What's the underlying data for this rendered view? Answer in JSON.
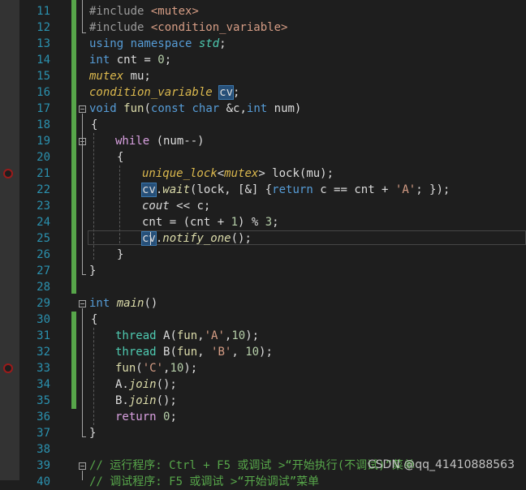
{
  "line_numbers": [
    "11",
    "12",
    "13",
    "14",
    "15",
    "16",
    "17",
    "18",
    "19",
    "20",
    "21",
    "22",
    "23",
    "24",
    "25",
    "26",
    "27",
    "28",
    "29",
    "30",
    "31",
    "32",
    "33",
    "34",
    "35",
    "36",
    "37",
    "38",
    "39",
    "40"
  ],
  "code": {
    "l11": {
      "a": "#include ",
      "b": "<mutex>"
    },
    "l12": {
      "a": "#include ",
      "b": "<condition_variable>"
    },
    "l13": {
      "a": "using ",
      "b": "namespace ",
      "c": "std",
      ";": ";"
    },
    "l14": {
      "a": "int ",
      "b": "cnt = ",
      "c": "0",
      "d": ";"
    },
    "l15": {
      "a": "mutex ",
      "b": "mu;"
    },
    "l16": {
      "a": "condition_variable ",
      "b": "cv",
      ";": ";"
    },
    "l17": {
      "a": "void ",
      "b": "fun",
      "c": "(",
      "d": "const ",
      "e": "char ",
      "f": "&c,",
      "g": "int ",
      "h": "num)"
    },
    "l18": {
      "a": "{"
    },
    "l19": {
      "a": "while ",
      "b": "(num--)"
    },
    "l20": {
      "a": "{"
    },
    "l21": {
      "a": "unique_lock",
      "b": "<",
      "c": "mutex",
      "d": "> lock(mu);"
    },
    "l22": {
      "a": "cv",
      "b": ".",
      "c": "wait",
      "d": "(lock, [&] {",
      "e": "return ",
      "f": "c == cnt + ",
      "g": "'A'",
      "h": "; });"
    },
    "l23": {
      "a": "cout ",
      "b": "<< c;"
    },
    "l24": {
      "a": "cnt = (cnt + ",
      "b": "1",
      ")": ") % ",
      "c": "3",
      ";": ";"
    },
    "l25": {
      "a": "cv",
      "b": ".",
      "c": "notify_one",
      "d": "();"
    },
    "l26": {
      "a": "}"
    },
    "l27": {
      "a": "}"
    },
    "l29": {
      "a": "int ",
      "b": "main",
      "c": "()"
    },
    "l30": {
      "a": "{"
    },
    "l31": {
      "a": "thread ",
      "b": "A(",
      "c": "fun",
      ",": ",",
      "d": "'A'",
      ",2": ",",
      "e": "10",
      "f": ");"
    },
    "l32": {
      "a": "thread ",
      "b": "B(",
      "c": "fun",
      ",": ", ",
      "d": "'B'",
      ",2": ", ",
      "e": "10",
      "f": ");"
    },
    "l33": {
      "a": "fun",
      "b": "(",
      "c": "'C'",
      ",": ",",
      "d": "10",
      "e": ");"
    },
    "l34": {
      "a": "A.",
      "b": "join",
      "c": "();"
    },
    "l35": {
      "a": "B.",
      "b": "join",
      "c": "();"
    },
    "l36": {
      "a": "return ",
      "b": "0",
      ";": ";"
    },
    "l37": {
      "a": "}"
    },
    "l39": {
      "a": "// 运行程序: Ctrl + F5 或调试 >“开始执行(不调试)”菜单"
    },
    "l40": {
      "a": "// 调试程序: F5 或调试 >“开始调试”菜单"
    }
  },
  "watermark": "CSDN @qq_41410888563",
  "breakpoint_lines": [
    "21",
    "33"
  ],
  "colors": {
    "background": "#1e1e1e",
    "line_number": "#2b91af",
    "keyword": "#569cd6",
    "type": "#4ec9b0",
    "function": "#dcdcaa",
    "comment": "#57a64a",
    "change_bar": "#57a64a",
    "breakpoint": "#9b1b1b"
  }
}
